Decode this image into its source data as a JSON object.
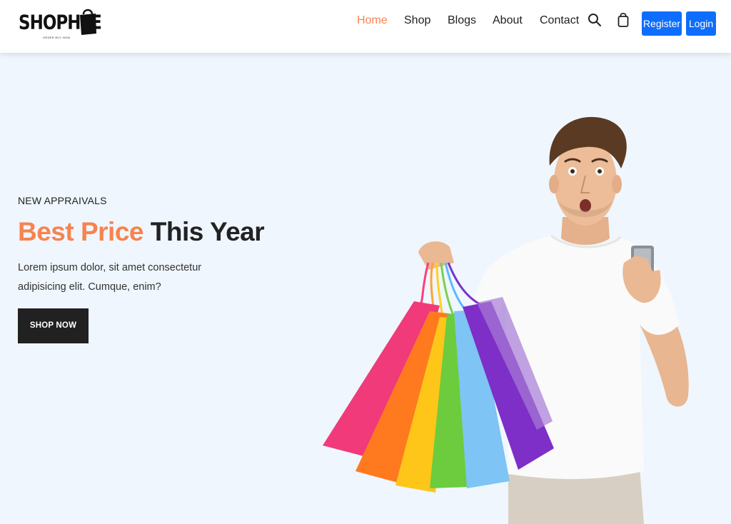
{
  "brand": {
    "name": "SHOPHEE",
    "tagline": "ORDER BUY NOW"
  },
  "nav": {
    "links": [
      {
        "label": "Home",
        "active": true
      },
      {
        "label": "Shop",
        "active": false
      },
      {
        "label": "Blogs",
        "active": false
      },
      {
        "label": "About",
        "active": false
      },
      {
        "label": "Contact",
        "active": false
      }
    ],
    "icons": [
      "search-icon",
      "shopping-bag-icon"
    ],
    "register_label": "Register",
    "login_label": "Login"
  },
  "hero": {
    "subheading": "NEW APPRAIVALS",
    "title_accent": "Best Price",
    "title_rest": "This Year",
    "description": "Lorem ipsum dolor, sit amet consectetur adipisicing elit. Cumque, enim?",
    "cta_label": "SHOP NOW"
  },
  "colors": {
    "accent": "#f7834f",
    "primary_button": "#0d6efd",
    "hero_background": "#eff6fd",
    "dark_button": "#212121"
  }
}
